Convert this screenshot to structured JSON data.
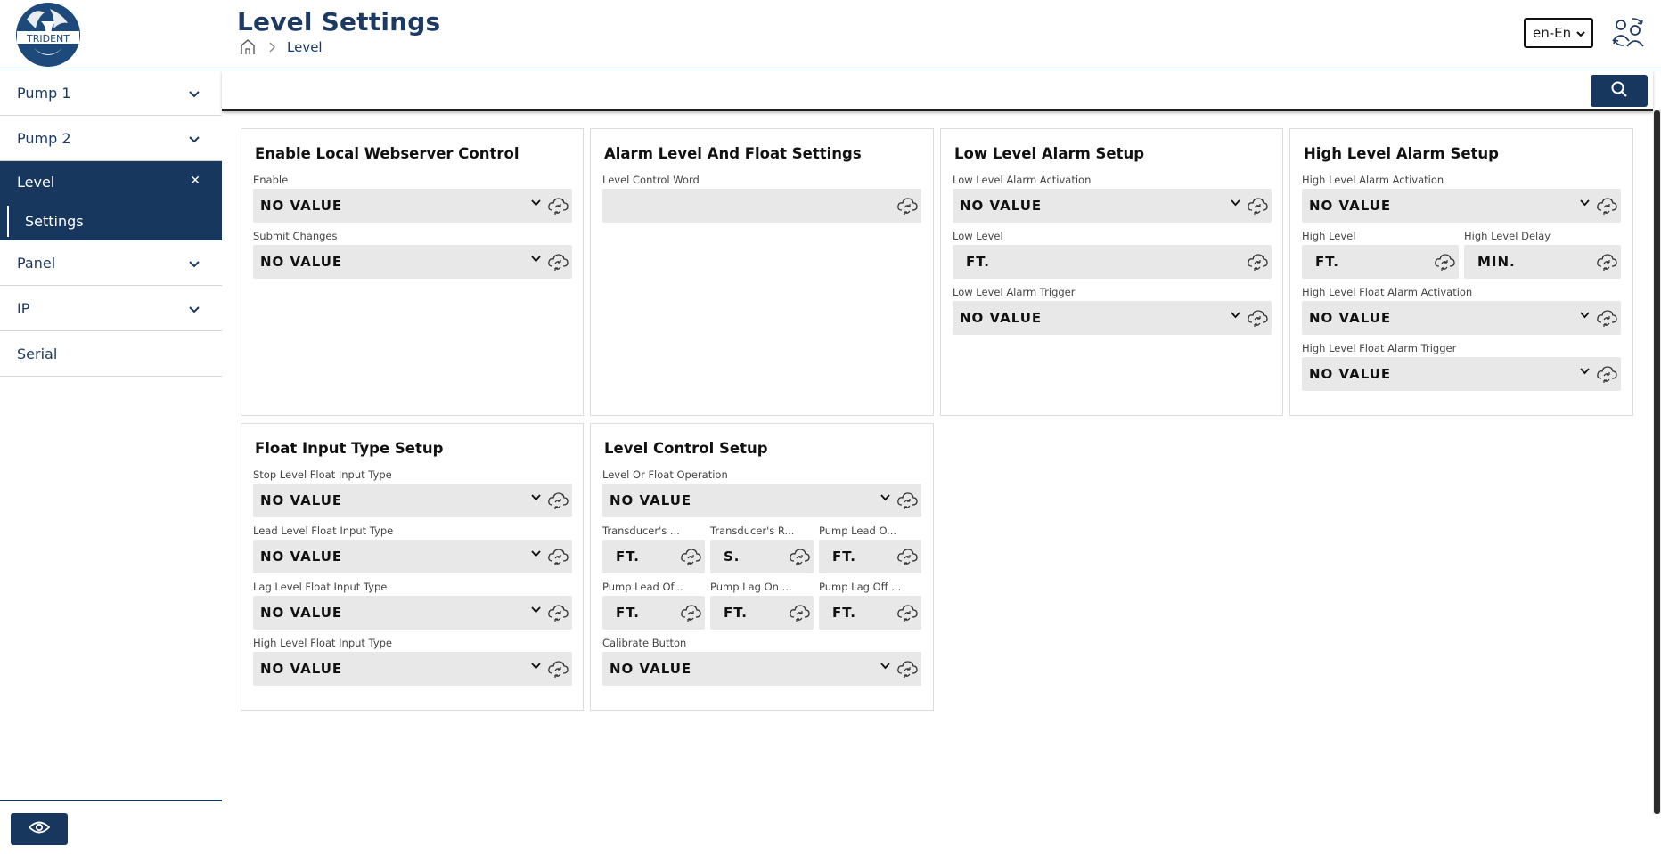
{
  "header": {
    "logo_text": "TRIDENT",
    "title": "Level Settings",
    "breadcrumb": [
      "Level"
    ],
    "language": "en-En"
  },
  "sidebar": {
    "items": [
      {
        "label": "Pump 1",
        "icon": "chevron-down-icon"
      },
      {
        "label": "Pump 2",
        "icon": "chevron-down-icon"
      },
      {
        "label": "Level",
        "icon": "close-icon",
        "active": true,
        "children": [
          "Settings"
        ]
      },
      {
        "label": "Panel",
        "icon": "chevron-down-icon"
      },
      {
        "label": "IP",
        "icon": "chevron-down-icon"
      },
      {
        "label": "Serial"
      }
    ]
  },
  "colors": {
    "primary": "#17375e",
    "field_bg": "#e8e8e8"
  },
  "cards": {
    "webserver": {
      "title": "Enable Local Webserver Control",
      "fields": [
        {
          "label": "Enable",
          "value": "NO VALUE"
        },
        {
          "label": "Submit Changes",
          "value": "NO VALUE"
        }
      ]
    },
    "alarm_float": {
      "title": "Alarm Level And Float Settings",
      "fields": [
        {
          "label": "Level Control Word",
          "value": ""
        }
      ]
    },
    "low_level": {
      "title": "Low Level Alarm Setup",
      "fields": [
        {
          "label": "Low Level Alarm Activation",
          "value": "NO VALUE"
        },
        {
          "label": "Low Level",
          "value": "FT."
        },
        {
          "label": "Low Level Alarm Trigger",
          "value": "NO VALUE"
        }
      ]
    },
    "high_level": {
      "title": "High Level Alarm Setup",
      "fields": [
        {
          "label": "High Level Alarm Activation",
          "value": "NO VALUE"
        },
        {
          "label": "High Level",
          "value": "FT."
        },
        {
          "label": "High Level Delay",
          "value": "MIN."
        },
        {
          "label": "High Level Float Alarm Activation",
          "value": "NO VALUE"
        },
        {
          "label": "High Level Float Alarm Trigger",
          "value": "NO VALUE"
        }
      ]
    },
    "float_input": {
      "title": "Float Input Type Setup",
      "fields": [
        {
          "label": "Stop Level Float Input Type",
          "value": "NO VALUE"
        },
        {
          "label": "Lead Level Float Input Type",
          "value": "NO VALUE"
        },
        {
          "label": "Lag Level Float Input Type",
          "value": "NO VALUE"
        },
        {
          "label": "High Level Float Input Type",
          "value": "NO VALUE"
        }
      ]
    },
    "level_control": {
      "title": "Level Control Setup",
      "fields": [
        {
          "label": "Level Or Float Operation",
          "value": "NO VALUE"
        },
        {
          "label": "Transducer's ...",
          "value": "FT."
        },
        {
          "label": "Transducer's R...",
          "value": "S."
        },
        {
          "label": "Pump Lead O...",
          "value": "FT."
        },
        {
          "label": "Pump Lead Of...",
          "value": "FT."
        },
        {
          "label": "Pump Lag On ...",
          "value": "FT."
        },
        {
          "label": "Pump Lag Off ...",
          "value": "FT."
        },
        {
          "label": "Calibrate Button",
          "value": "NO VALUE"
        }
      ]
    }
  }
}
